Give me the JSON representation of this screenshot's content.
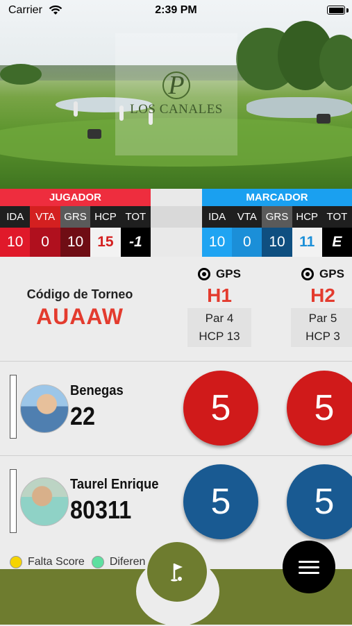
{
  "status": {
    "carrier": "Carrier",
    "time": "2:39 PM"
  },
  "logo": {
    "mark": "P",
    "name": "LOS CANALES"
  },
  "jugador": {
    "title": "JUGADOR",
    "columns": [
      "IDA",
      "VTA",
      "GRS",
      "HCP",
      "TOT"
    ],
    "values": [
      "10",
      "0",
      "10",
      "15",
      "-1"
    ]
  },
  "marcador": {
    "title": "MARCADOR",
    "columns": [
      "IDA",
      "VTA",
      "GRS",
      "HCP",
      "TOT"
    ],
    "values": [
      "10",
      "0",
      "10",
      "11",
      "E"
    ]
  },
  "torneo": {
    "label": "Código de Torneo",
    "code": "AUAAW"
  },
  "holes": [
    {
      "gps": "GPS",
      "name": "H1",
      "par": "Par 4",
      "hcp": "HCP 13"
    },
    {
      "gps": "GPS",
      "name": "H2",
      "par": "Par 5",
      "hcp": "HCP 3"
    }
  ],
  "players": [
    {
      "name": "Benegas",
      "hcp": "22",
      "scores": [
        "5",
        "5"
      ],
      "color": "#d01a1a"
    },
    {
      "name": "Taurel Enrique",
      "hcp": "80311",
      "scores": [
        "5",
        "5"
      ],
      "color": "#195a92"
    }
  ],
  "legend": [
    {
      "label": "Falta Score",
      "color": "#f5d400"
    },
    {
      "label": "Diferen",
      "color": "#5ee0a0"
    }
  ],
  "icons": {
    "wifi": "wifi-icon",
    "battery": "battery-icon",
    "gps": "crosshair-icon",
    "flag": "golf-flag-icon",
    "menu": "hamburger-menu-icon"
  }
}
